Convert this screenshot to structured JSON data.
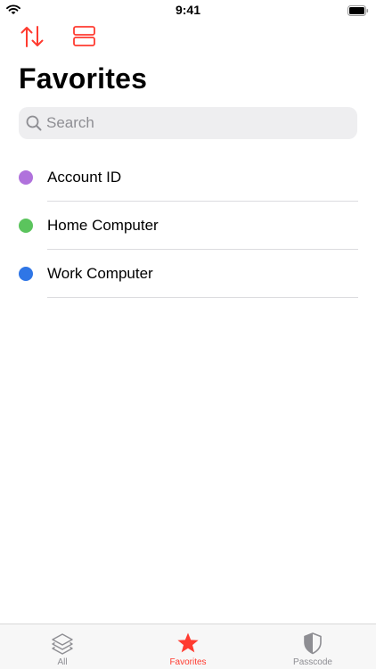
{
  "status_bar": {
    "time": "9:41"
  },
  "page": {
    "title": "Favorites"
  },
  "search": {
    "placeholder": "Search"
  },
  "favorites": [
    {
      "label": "Account ID",
      "color": "#b072dc"
    },
    {
      "label": "Home Computer",
      "color": "#5bc45d"
    },
    {
      "label": "Work Computer",
      "color": "#2f76e6"
    }
  ],
  "tab_bar": {
    "tabs": [
      {
        "label": "All",
        "icon": "layers-icon",
        "selected": false
      },
      {
        "label": "Favorites",
        "icon": "star-icon",
        "selected": true
      },
      {
        "label": "Passcode",
        "icon": "shield-icon",
        "selected": false
      }
    ]
  },
  "colors": {
    "accent": "#ff3b30",
    "inactive": "#8e8e93"
  }
}
